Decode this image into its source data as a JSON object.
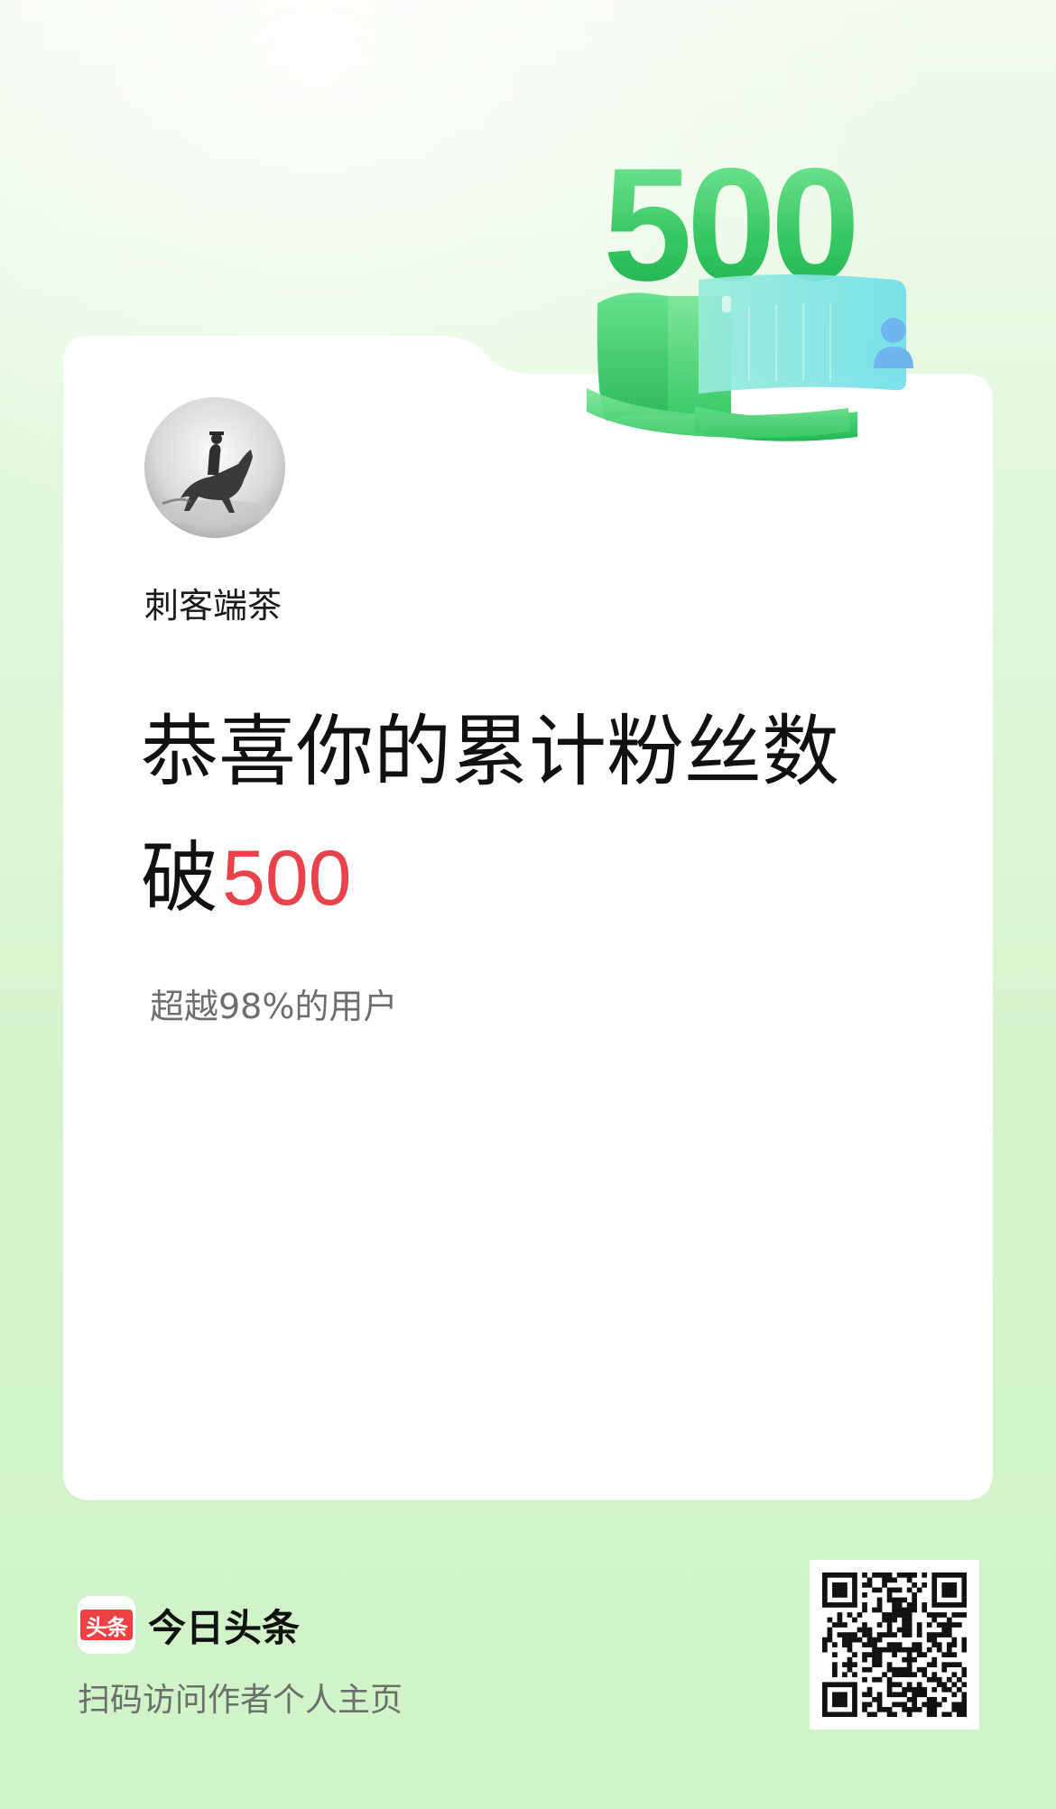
{
  "profile": {
    "username": "刺客端茶"
  },
  "milestone": {
    "badge_number": "500"
  },
  "message": {
    "line1": "恭喜你的累计粉丝数",
    "line2_prefix": "破",
    "follower_count": "500",
    "percentile_text": "超越98%的用户"
  },
  "footer": {
    "logo_text": "头条",
    "brand_name": "今日头条",
    "scan_hint": "扫码访问作者个人主页"
  },
  "colors": {
    "accent_red": "#e8424a",
    "accent_green": "#3fd36a",
    "brand_red": "#f04142"
  },
  "icons": {
    "avatar": "horse-rider-photo",
    "badge": "milestone-500-badge",
    "qr": "qr-code"
  }
}
